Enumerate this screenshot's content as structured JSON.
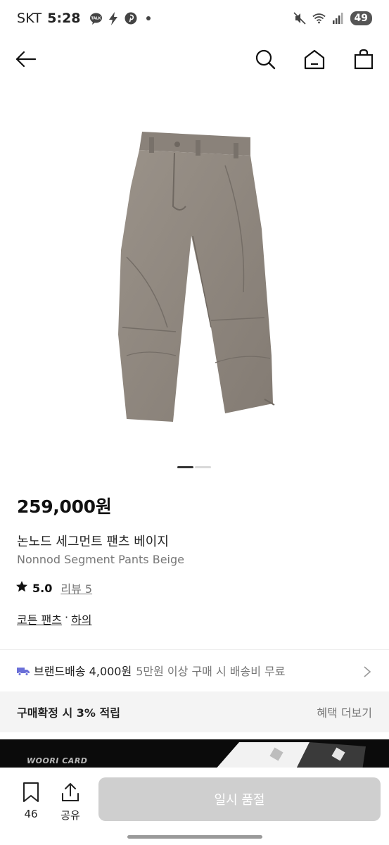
{
  "status_bar": {
    "carrier": "SKT",
    "time": "5:28",
    "talk_badge": "TALK",
    "battery": "49"
  },
  "product": {
    "price": "259,000원",
    "name_ko": "논노드 세그먼트 팬츠 베이지",
    "name_en": "Nonnod Segment Pants Beige",
    "rating": "5.0",
    "review_label": "리뷰 5",
    "category_primary": "코튼 팬츠",
    "category_separator": "·",
    "category_secondary": "하의",
    "image_count": 2,
    "image_index": 1
  },
  "delivery": {
    "label": "브랜드배송 4,000원",
    "description": "5만원 이상 구매 시 배송비 무료"
  },
  "benefit": {
    "label": "구매확정 시 3% 적립",
    "more_label": "혜택 더보기"
  },
  "banner": {
    "text": "WOORI CARD"
  },
  "bottom_bar": {
    "bookmark_count": "46",
    "share_label": "공유",
    "buy_label": "일시 품절"
  },
  "colors": {
    "pants": "#8f877e",
    "accent_delivery": "#6a6fd8",
    "buy_disabled": "#cfcfcf"
  }
}
